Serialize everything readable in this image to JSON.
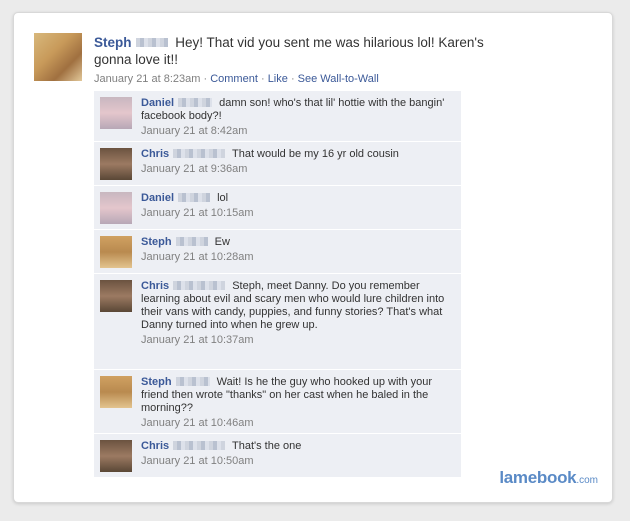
{
  "post": {
    "author": "Steph",
    "text": "Hey! That vid you sent me was hilarious lol! Karen's gonna love it!!",
    "time": "January 21 at 8:23am",
    "sep1": "·",
    "comment_link": "Comment",
    "sep2": "·",
    "like_link": "Like",
    "sep3": "·",
    "wall_link": "See Wall-to-Wall"
  },
  "comments": [
    {
      "author": "Daniel",
      "text": "damn son! who's that lil' hottie with the bangin' facebook body?!",
      "time": "January 21 at 8:42am"
    },
    {
      "author": "Chris",
      "text": "That would be my 16 yr old cousin",
      "time": "January 21 at 9:36am"
    },
    {
      "author": "Daniel",
      "text": "lol",
      "time": "January 21 at 10:15am"
    },
    {
      "author": "Steph",
      "text": "Ew",
      "time": "January 21 at 10:28am"
    },
    {
      "author": "Chris",
      "text": "Steph, meet Danny. Do you remember learning about evil and scary men who would lure children into their vans with candy, puppies, and funny stories? That's what Danny turned into when he grew up.",
      "time": "January 21 at 10:37am"
    },
    {
      "author": "Steph",
      "text": "Wait! Is he the guy who hooked up with your friend then wrote \"thanks\" on her cast when he baled in the morning??",
      "time": "January 21 at 10:46am"
    },
    {
      "author": "Chris",
      "text": "That's the one",
      "time": "January 21 at 10:50am"
    }
  ],
  "logo": {
    "brand": "lamebook",
    "suffix": ".com"
  }
}
